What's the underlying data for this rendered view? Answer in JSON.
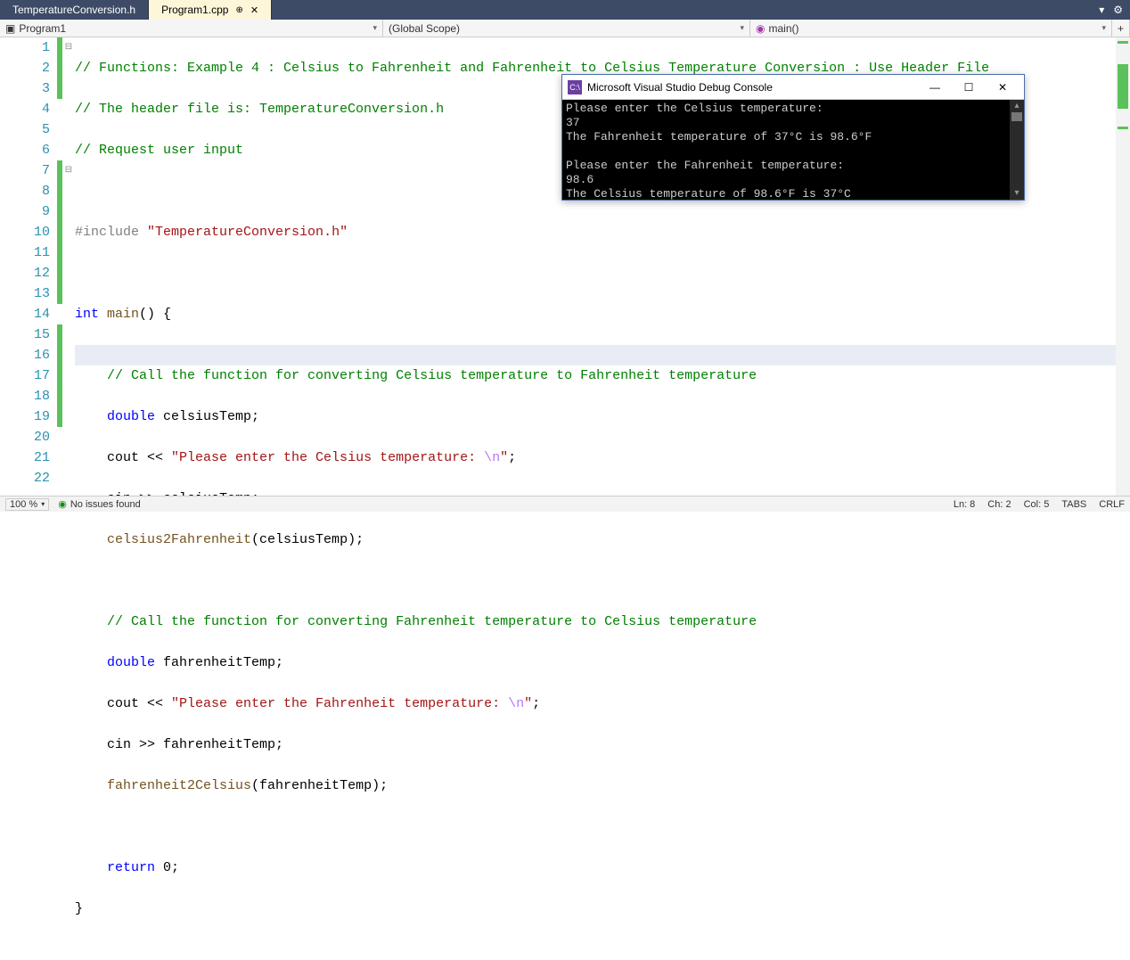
{
  "tabs": {
    "inactive": "TemperatureConversion.h",
    "active": "Program1.cpp",
    "pin_glyph": "⊕",
    "close_glyph": "✕",
    "right_chevron": "▾",
    "gear": "⚙"
  },
  "nav": {
    "project": "Program1",
    "scope": "(Global Scope)",
    "member": "main()",
    "plus": "+"
  },
  "code": {
    "l1": "// Functions: Example 4 : Celsius to Fahrenheit and Fahrenheit to Celsius Temperature Conversion : Use Header File",
    "l2": "// The header file is: TemperatureConversion.h",
    "l3": "// Request user input",
    "l5_pre": "#include",
    "l5_str": "\"TemperatureConversion.h\"",
    "l7_kw1": "int",
    "l7_fn": "main",
    "l7_rest": "() {",
    "l9": "// Call the function for converting Celsius temperature to Fahrenheit temperature",
    "l10_kw": "double",
    "l10_rest": " celsiusTemp;",
    "l11_a": "cout << ",
    "l11_str": "\"Please enter the Celsius temperature: ",
    "l11_esc": "\\n",
    "l11_end": "\"",
    "l11_semi": ";",
    "l12": "cin >> celsiusTemp;",
    "l13_fn": "celsius2Fahrenheit",
    "l13_rest": "(celsiusTemp);",
    "l15": "// Call the function for converting Fahrenheit temperature to Celsius temperature",
    "l16_kw": "double",
    "l16_rest": " fahrenheitTemp;",
    "l17_a": "cout << ",
    "l17_str": "\"Please enter the Fahrenheit temperature: ",
    "l17_esc": "\\n",
    "l17_end": "\"",
    "l17_semi": ";",
    "l18": "cin >> fahrenheitTemp;",
    "l19_fn": "fahrenheit2Celsius",
    "l19_rest": "(fahrenheitTemp);",
    "l21_kw": "return",
    "l21_rest": " 0;",
    "l22": "}"
  },
  "console": {
    "title": "Microsoft Visual Studio Debug Console",
    "ico": "C:\\",
    "lines": [
      "Please enter the Celsius temperature:",
      "37",
      "The Fahrenheit temperature of 37°C is 98.6°F",
      "",
      "Please enter the Fahrenheit temperature:",
      "98.6",
      "The Celsius temperature of 98.6°F is 37°C"
    ]
  },
  "status": {
    "zoom": "100 %",
    "issues": "No issues found",
    "ln": "Ln: 8",
    "ch": "Ch: 2",
    "col": "Col: 5",
    "tabs": "TABS",
    "crlf": "CRLF"
  }
}
